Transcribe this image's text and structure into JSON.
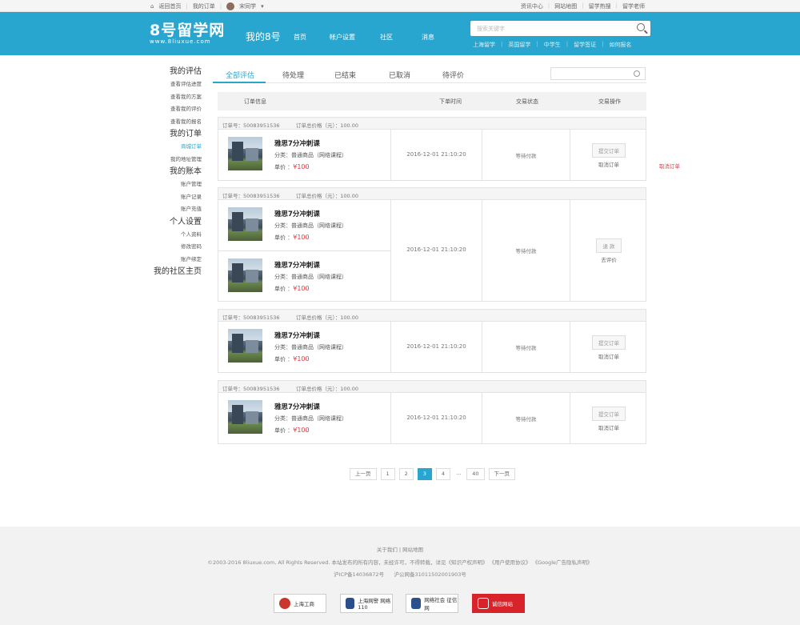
{
  "topbar": {
    "home": "返回首页",
    "my_orders": "我的订单",
    "user": "宋同学",
    "right": [
      "资讯中心",
      "网站地图",
      "留学热搜",
      "留学老师"
    ]
  },
  "header": {
    "logo": "8号留学网",
    "logo_url": "www.8liuxue.com",
    "my8": "我的8号",
    "nav": [
      "首页",
      "帐户设置",
      "社区",
      "消息"
    ],
    "search_placeholder": "搜索关键字",
    "hot": [
      "上海留学",
      "英国留学",
      "中学生",
      "留学签证",
      "如何报名"
    ]
  },
  "sidebar": [
    {
      "head": "我的评估",
      "items": [
        "查看评估进度",
        "查看我的方案",
        "查看我的评价",
        "查看我的报名"
      ]
    },
    {
      "head": "我的订单",
      "items": [
        "商城订单",
        "我的地址管理"
      ]
    },
    {
      "head": "我的账本",
      "items": [
        "账户管理",
        "账户记录",
        "账户充值"
      ]
    },
    {
      "head": "个人设置",
      "items": [
        "个人资料",
        "修改密码",
        "账户绑定"
      ]
    },
    {
      "head": "我的社区主页",
      "items": []
    }
  ],
  "tabs": [
    "全部评估",
    "待处理",
    "已结束",
    "已取消",
    "待评价"
  ],
  "thead": [
    "订单信息",
    "下单时间",
    "交易状态",
    "交易操作"
  ],
  "orders": [
    {
      "no": "订单号：50083951536",
      "total": "订单总价格（元）：100.00",
      "items": [
        {
          "name": "雅思7分冲刺课",
          "cat": "分类：普通商品（网络课程）",
          "price_label": "单价 ：",
          "price": "¥100"
        }
      ],
      "time": "2016-12-01 21:10:20",
      "status": "等待付款",
      "btn": "提交订单",
      "link": "取消订单"
    },
    {
      "no": "订单号：50083951536",
      "total": "订单总价格（元）：100.00",
      "items": [
        {
          "name": "雅思7分冲刺课",
          "cat": "分类：普通商品（网络课程）",
          "price_label": "单价 ：",
          "price": "¥100"
        },
        {
          "name": "雅思7分冲刺课",
          "cat": "分类：普通商品（网络课程）",
          "price_label": "单价 ：",
          "price": "¥100"
        }
      ],
      "time": "2016-12-01 21:10:20",
      "status": "等待付款",
      "btn": "退 款",
      "link": "去评价"
    },
    {
      "no": "订单号：50083951536",
      "total": "订单总价格（元）：100.00",
      "items": [
        {
          "name": "雅思7分冲刺课",
          "cat": "分类：普通商品（网络课程）",
          "price_label": "单价 ：",
          "price": "¥100"
        }
      ],
      "time": "2016-12-01 21:10:20",
      "status": "等待付款",
      "btn": "提交订单",
      "link": "取消订单"
    },
    {
      "no": "订单号：50083951536",
      "total": "订单总价格（元）：100.00",
      "items": [
        {
          "name": "雅思7分冲刺课",
          "cat": "分类：普通商品（网络课程）",
          "price_label": "单价 ：",
          "price": "¥100"
        }
      ],
      "time": "2016-12-01 21:10:20",
      "status": "等待付款",
      "btn": "提交订单",
      "link": "取消订单"
    }
  ],
  "cancel_red": "取消订单",
  "pager": {
    "prev": "上一页",
    "pages": [
      "1",
      "2",
      "3",
      "4"
    ],
    "current": "3",
    "dots": "...",
    "last": "40",
    "next": "下一页"
  },
  "footer": {
    "links": "关于我们 | 网站地图",
    "copy": "©2003-2016 8liuxue.com, All Rights Reserved.   本站发布的所有内容，未经许可，不得转载，详见《知识产权声明》 《用户使用协议》 《Google广告隐私声明》",
    "icp": "沪ICP备14036872号",
    "police": "沪公网备31011502001903号",
    "badges": [
      "上海工商",
      "上海网警 网络110",
      "网络社会 征信网",
      "诚信网站"
    ]
  },
  "colors": {
    "brand": "#29a6cf",
    "price": "#e4393c"
  }
}
